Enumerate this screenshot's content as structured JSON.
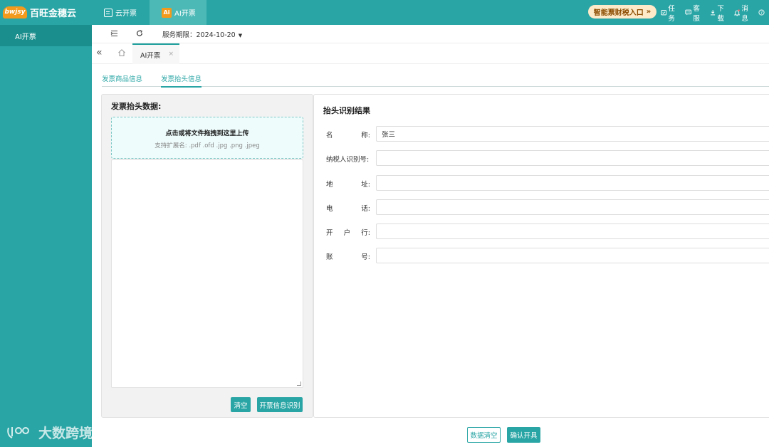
{
  "brand": {
    "badge": "bwjsy",
    "name": "百旺金穗云"
  },
  "top_tabs": [
    {
      "label": "云开票"
    },
    {
      "label": "AI开票",
      "icon_text": "Ai"
    }
  ],
  "entry_button": {
    "label": "智能票财税入口",
    "chevron": "»"
  },
  "top_links": [
    {
      "label": "任务",
      "icon": "task-icon"
    },
    {
      "label": "客服",
      "icon": "chat-icon"
    },
    {
      "label": "下载",
      "icon": "download-icon"
    },
    {
      "label": "消息",
      "icon": "bell-icon"
    }
  ],
  "help_glyph": "?",
  "sidebar": {
    "items": [
      {
        "label": "AI开票",
        "active": true
      }
    ]
  },
  "watermark": {
    "text": "大数跨境"
  },
  "navbar": {
    "service_label": "服务期限：2024-10-20"
  },
  "view_tabs": [
    {
      "label": "AI开票",
      "close": "×"
    }
  ],
  "sub_tabs": [
    {
      "label": "发票商品信息",
      "active": false
    },
    {
      "label": "发票抬头信息",
      "active": true
    }
  ],
  "left_panel": {
    "title": "发票抬头数据:",
    "upload_main": "点击或将文件拖拽到这里上传",
    "upload_sub": "支持扩展名: .pdf .ofd .jpg .png .jpeg",
    "clear_button": "清空",
    "recognize_button": "开票信息识别"
  },
  "right_panel": {
    "title": "抬头识别结果",
    "fields": [
      {
        "label_parts": [
          "名",
          "称:"
        ],
        "value": "张三"
      },
      {
        "label_parts": [
          "纳税人识别号:"
        ],
        "value": ""
      },
      {
        "label_parts": [
          "地",
          "址:"
        ],
        "value": ""
      },
      {
        "label_parts": [
          "电",
          "话:"
        ],
        "value": ""
      },
      {
        "label_parts": [
          "开",
          "户",
          "行:"
        ],
        "value": ""
      },
      {
        "label_parts": [
          "账",
          "号:"
        ],
        "value": ""
      }
    ]
  },
  "footer": {
    "clear_button": "数据清空",
    "confirm_button": "确认开具"
  },
  "colors": {
    "primary": "#2aa5a5",
    "sidebar_active": "#1a8e8c",
    "accent_orange": "#f39a1c"
  }
}
